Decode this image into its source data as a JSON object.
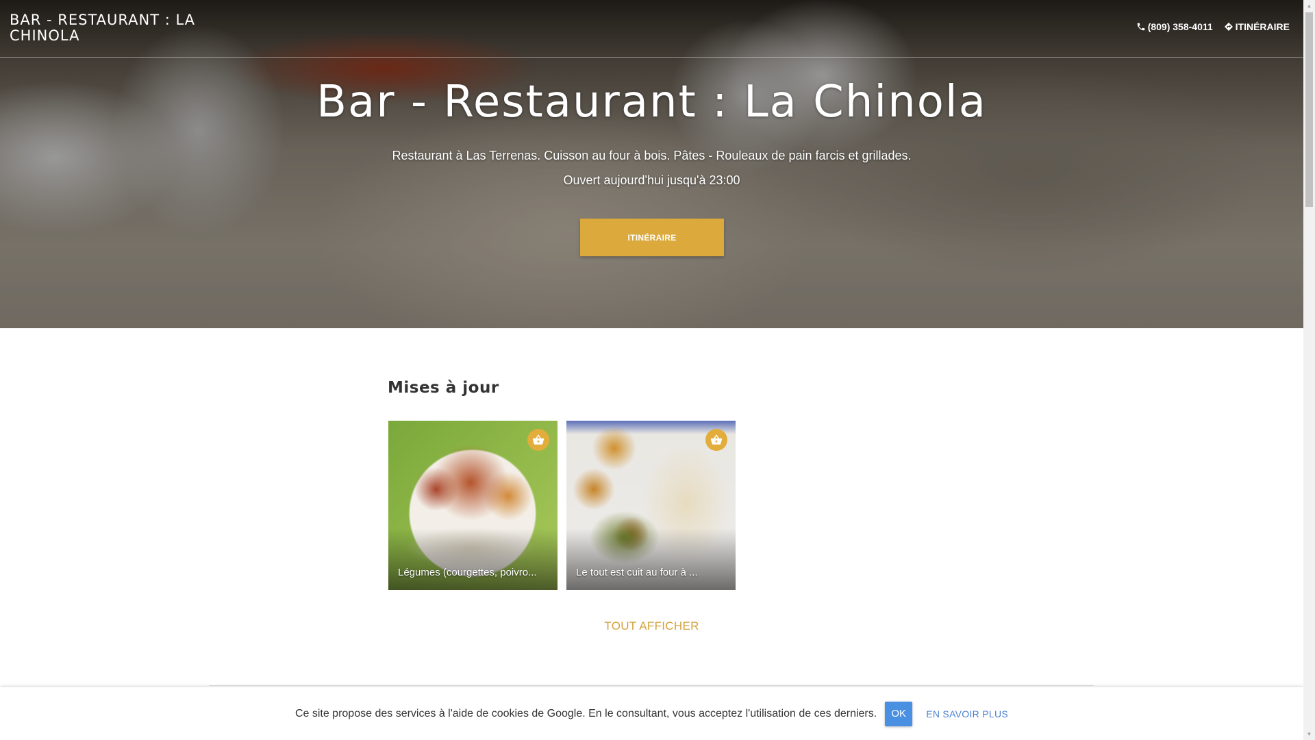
{
  "header": {
    "brand": "BAR - RESTAURANT : LA CHINOLA",
    "phone": "(809) 358-4011",
    "directions": "ITINÉRAIRE",
    "icons": {
      "phone": "phone-icon",
      "directions": "directions-icon"
    }
  },
  "hero": {
    "title": "Bar - Restaurant : La Chinola",
    "description": "Restaurant à Las Terrenas. Cuisson au four à bois. Pâtes - Rouleaux de pain farcis et grillades.",
    "hours": "Ouvert aujourd'hui jusqu'à 23:00",
    "button": "ITINÉRAIRE"
  },
  "updates": {
    "title": "Mises à jour",
    "cards": [
      {
        "caption": "Légumes (courgettes, poivro...",
        "icon": "basket-icon"
      },
      {
        "caption": "Le tout est cuit au four à ...",
        "icon": "basket-icon"
      }
    ],
    "view_all": "TOUT AFFICHER"
  },
  "cookie": {
    "text": "Ce site propose des services à l'aide de cookies de Google. En le consultant, vous acceptez l'utilisation de ces derniers.",
    "ok": "OK",
    "more": "EN SAVOIR PLUS"
  },
  "colors": {
    "accent": "#dba93c",
    "link_blue": "#4a7fd1",
    "ok_button": "#4a90e2"
  }
}
